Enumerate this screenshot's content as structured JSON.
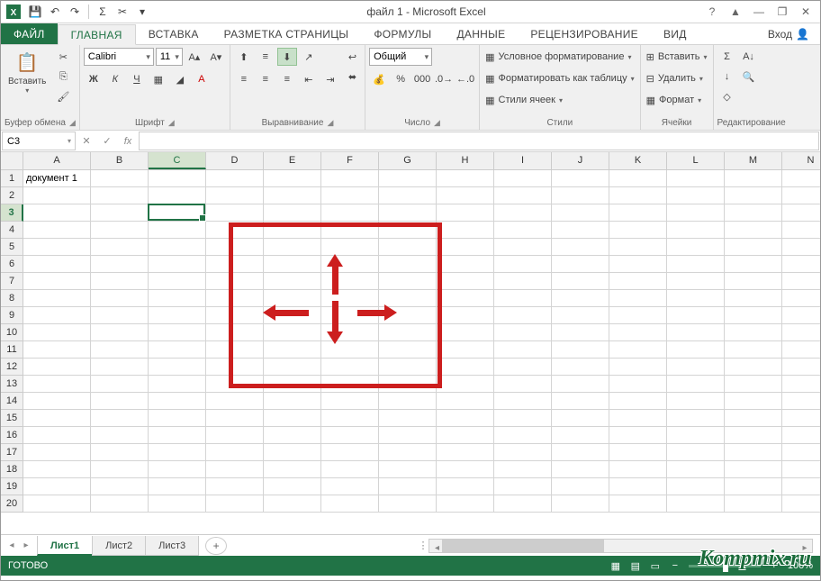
{
  "title": "файл 1 - Microsoft Excel",
  "qat": {
    "save": "💾",
    "undo": "↶",
    "redo": "↷",
    "autosum": "Σ",
    "cut": "✂"
  },
  "win": {
    "help": "?",
    "ribbon": "▲",
    "min": "—",
    "max": "❐",
    "close": "✕"
  },
  "tabs": {
    "file": "ФАЙЛ",
    "home": "ГЛАВНАЯ",
    "insert": "ВСТАВКА",
    "layout": "РАЗМЕТКА СТРАНИЦЫ",
    "formulas": "ФОРМУЛЫ",
    "data": "ДАННЫЕ",
    "review": "РЕЦЕНЗИРОВАНИЕ",
    "view": "ВИД"
  },
  "signin": "Вход",
  "ribbon": {
    "clipboard": {
      "paste": "Вставить",
      "label": "Буфер обмена"
    },
    "font": {
      "name": "Calibri",
      "size": "11",
      "bold": "Ж",
      "italic": "К",
      "underline": "Ч",
      "label": "Шрифт"
    },
    "alignment": {
      "label": "Выравнивание"
    },
    "number": {
      "format": "Общий",
      "label": "Число"
    },
    "styles": {
      "conditional": "Условное форматирование",
      "table": "Форматировать как таблицу",
      "cell": "Стили ячеек",
      "label": "Стили"
    },
    "cells": {
      "insert": "Вставить",
      "delete": "Удалить",
      "format": "Формат",
      "label": "Ячейки"
    },
    "editing": {
      "label": "Редактирование"
    }
  },
  "namebox": "C3",
  "columns": [
    "A",
    "B",
    "C",
    "D",
    "E",
    "F",
    "G",
    "H",
    "I",
    "J",
    "K",
    "L",
    "M",
    "N"
  ],
  "rows_count": 20,
  "active": {
    "col": "C",
    "row": 3
  },
  "cell_a1": "документ 1",
  "sheets": [
    "Лист1",
    "Лист2",
    "Лист3"
  ],
  "active_sheet": 0,
  "status": "ГОТОВО",
  "zoom": "100%",
  "watermark": "Kompmix.ru"
}
